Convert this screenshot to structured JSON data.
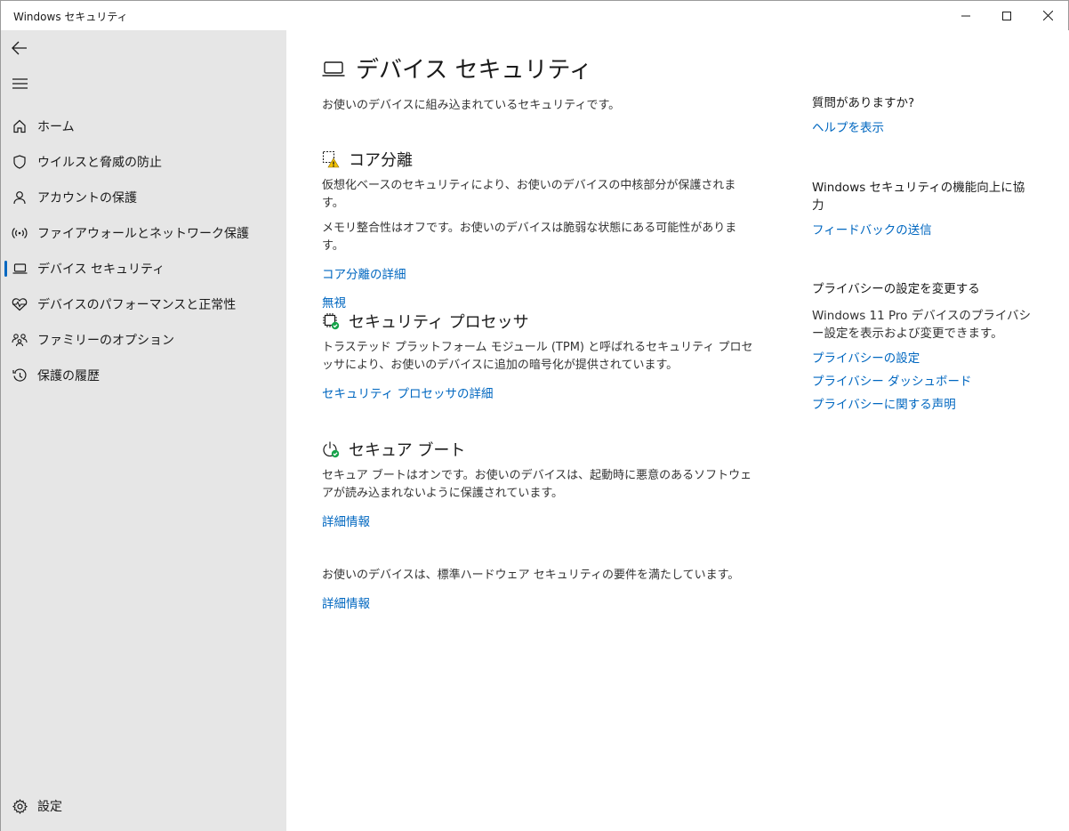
{
  "window": {
    "title": "Windows セキュリティ"
  },
  "sidebar": {
    "items": [
      {
        "label": "ホーム",
        "icon": "home-icon"
      },
      {
        "label": "ウイルスと脅威の防止",
        "icon": "shield-icon"
      },
      {
        "label": "アカウントの保護",
        "icon": "person-icon"
      },
      {
        "label": "ファイアウォールとネットワーク保護",
        "icon": "wifi-signal-icon"
      },
      {
        "label": "デバイス セキュリティ",
        "icon": "laptop-icon",
        "active": true
      },
      {
        "label": "デバイスのパフォーマンスと正常性",
        "icon": "heart-pulse-icon"
      },
      {
        "label": "ファミリーのオプション",
        "icon": "family-icon"
      },
      {
        "label": "保護の履歴",
        "icon": "history-icon"
      }
    ],
    "settings_label": "設定"
  },
  "main": {
    "title": "デバイス セキュリティ",
    "subtitle": "お使いのデバイスに組み込まれているセキュリティです。",
    "core_isolation": {
      "title": "コア分離",
      "text1": "仮想化ベースのセキュリティにより、お使いのデバイスの中核部分が保護されます。",
      "text2": "メモリ整合性はオフです。お使いのデバイスは脆弱な状態にある可能性があります。",
      "link_details": "コア分離の詳細",
      "link_ignore": "無視"
    },
    "security_processor": {
      "title": "セキュリティ プロセッサ",
      "text": "トラステッド プラットフォーム モジュール (TPM) と呼ばれるセキュリティ プロセッサにより、お使いのデバイスに追加の暗号化が提供されています。",
      "link_details": "セキュリティ プロセッサの詳細"
    },
    "secure_boot": {
      "title": "セキュア ブート",
      "text": "セキュア ブートはオンです。お使いのデバイスは、起動時に悪意のあるソフトウェアが読み込まれないように保護されています。",
      "link_details": "詳細情報"
    },
    "standard": {
      "text": "お使いのデバイスは、標準ハードウェア セキュリティの要件を満たしています。",
      "link_details": "詳細情報"
    }
  },
  "side": {
    "question": {
      "heading": "質問がありますか?",
      "link": "ヘルプを表示"
    },
    "feedback": {
      "heading": "Windows セキュリティの機能向上に協力",
      "link": "フィードバックの送信"
    },
    "privacy": {
      "heading": "プライバシーの設定を変更する",
      "text": "Windows 11 Pro デバイスのプライバシー設定を表示および変更できます。",
      "links": [
        "プライバシーの設定",
        "プライバシー ダッシュボード",
        "プライバシーに関する声明"
      ]
    }
  },
  "colors": {
    "accent": "#0067c0",
    "sidebar_bg": "#e6e6e6",
    "warning": "#f2c200",
    "ok": "#16a34a"
  }
}
